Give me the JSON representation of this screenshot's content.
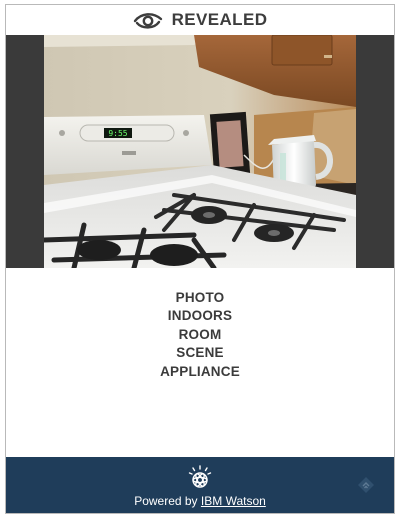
{
  "header": {
    "title": "REVEALED",
    "logo_icon": "eye-swirl-logo-icon"
  },
  "photo": {
    "subject": "kitchen gas stove with kettle",
    "clock_display": "9:55"
  },
  "tags": [
    "PHOTO",
    "INDOORS",
    "ROOM",
    "SCENE",
    "APPLIANCE"
  ],
  "footer": {
    "powered_prefix": "Powered by",
    "watson_link": "IBM Watson",
    "watson_icon": "ibm-watson-icon",
    "corner_icon": "feedly-icon",
    "background": "#1f3d5a"
  }
}
